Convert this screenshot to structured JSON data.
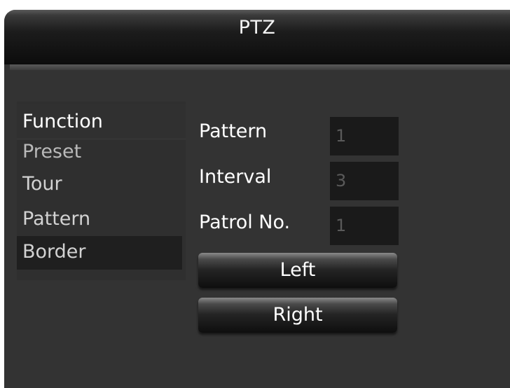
{
  "window": {
    "title": "PTZ"
  },
  "menu": {
    "items": [
      {
        "label": "Function"
      },
      {
        "label": "Preset"
      },
      {
        "label": "Tour"
      },
      {
        "label": "Pattern"
      },
      {
        "label": "Border"
      }
    ],
    "selected": "Border"
  },
  "form": {
    "pattern": {
      "label": "Pattern",
      "value": "1"
    },
    "interval": {
      "label": "Interval",
      "value": "3"
    },
    "patrol_no": {
      "label": "Patrol No.",
      "value": "1"
    }
  },
  "buttons": {
    "left_label": "Left",
    "right_label": "Right"
  },
  "colors": {
    "background": "#333333",
    "titlebar": "#111111",
    "text": "#ffffff",
    "field_bg": "#1a1a1a",
    "selected_bg": "#1f1f1f"
  }
}
